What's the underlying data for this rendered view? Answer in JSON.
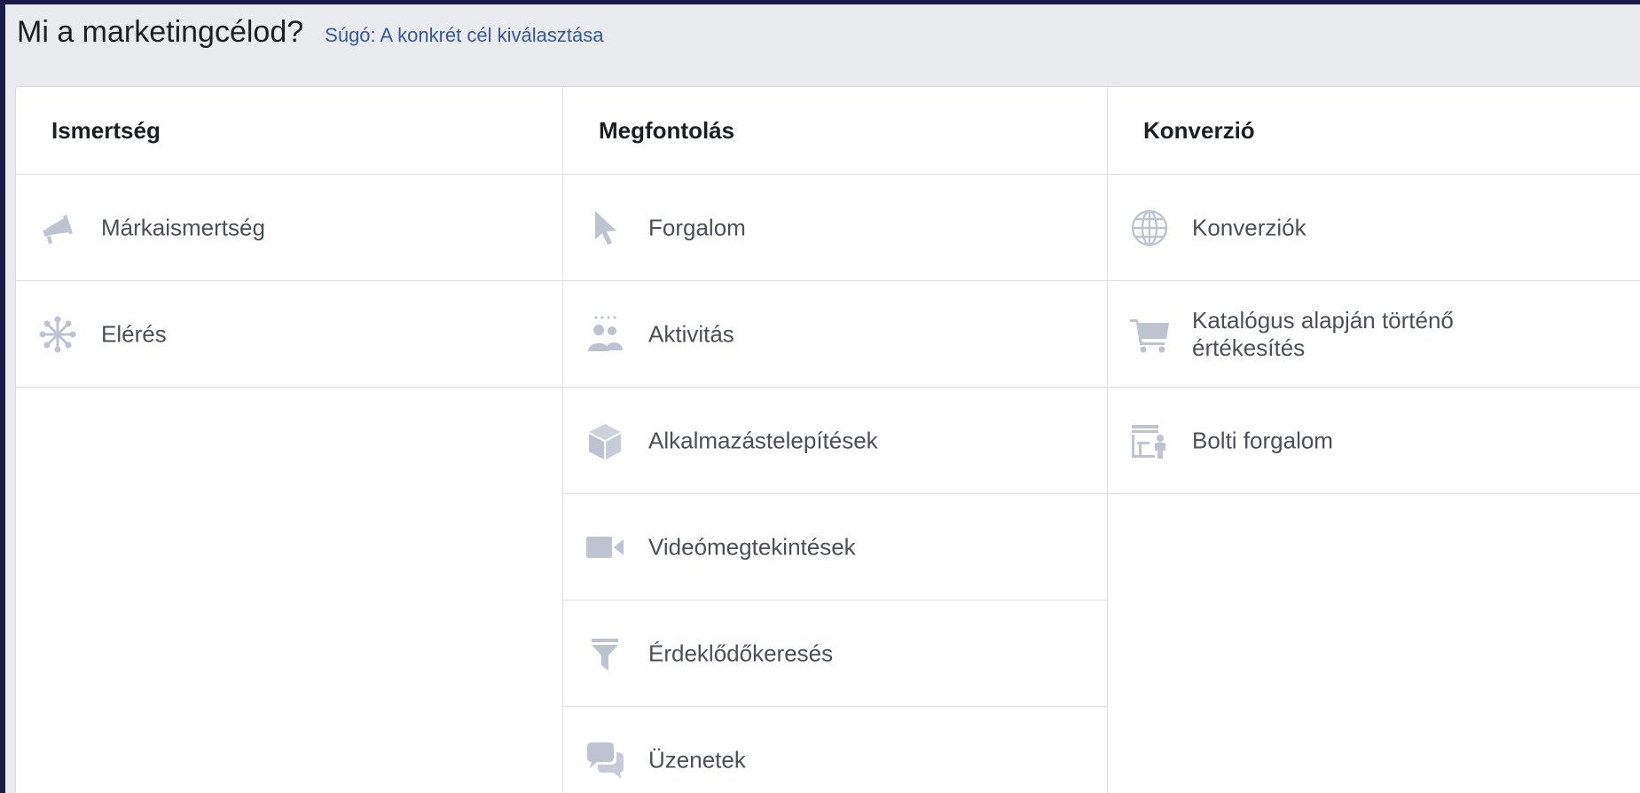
{
  "header": {
    "title": "Mi a marketingcélod?",
    "help_link": "Súgó: A konkrét cél kiválasztása"
  },
  "colors": {
    "icon": "#bec3d2",
    "link": "#365899",
    "text": "#4b4f56",
    "background": "#e9ebee"
  },
  "columns": [
    {
      "heading": "Ismertség",
      "items": [
        {
          "label": "Márkaismertség",
          "icon": "megaphone-icon"
        },
        {
          "label": "Elérés",
          "icon": "reach-network-icon"
        }
      ]
    },
    {
      "heading": "Megfontolás",
      "items": [
        {
          "label": "Forgalom",
          "icon": "cursor-icon"
        },
        {
          "label": "Aktivitás",
          "icon": "people-icon"
        },
        {
          "label": "Alkalmazástelepítések",
          "icon": "box-icon"
        },
        {
          "label": "Videómegtekintések",
          "icon": "video-camera-icon"
        },
        {
          "label": "Érdeklődőkeresés",
          "icon": "funnel-icon"
        },
        {
          "label": "Üzenetek",
          "icon": "chat-bubbles-icon"
        }
      ]
    },
    {
      "heading": "Konverzió",
      "items": [
        {
          "label": "Konverziók",
          "icon": "globe-icon"
        },
        {
          "label": "Katalógus alapján történő értékesítés",
          "icon": "shopping-cart-icon"
        },
        {
          "label": "Bolti forgalom",
          "icon": "store-icon"
        }
      ]
    }
  ]
}
